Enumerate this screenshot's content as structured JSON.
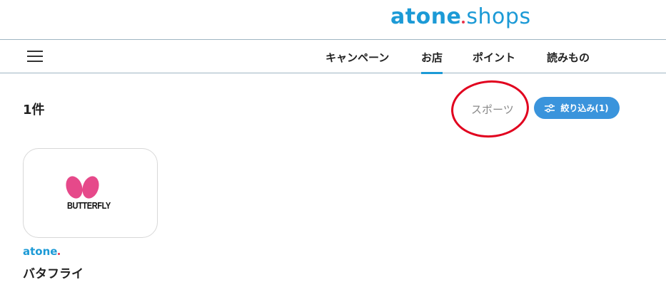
{
  "header": {
    "logo_brand": "atone",
    "logo_suffix": "shops"
  },
  "nav": {
    "items": [
      {
        "label": "キャンペーン",
        "active": false
      },
      {
        "label": "お店",
        "active": true
      },
      {
        "label": "ポイント",
        "active": false
      },
      {
        "label": "読みもの",
        "active": false
      }
    ]
  },
  "results": {
    "count_label": "1件",
    "category_label": "スポーツ",
    "filter_button_label": "絞り込み(1)"
  },
  "shops": [
    {
      "logo_text": "BUTTERFLY",
      "badge": "atone",
      "name": "バタフライ"
    }
  ],
  "colors": {
    "accent": "#1c9ad6",
    "filter_button": "#3a94dc",
    "annotation_circle": "#e1001e",
    "butterfly_pink": "#e6498a"
  }
}
